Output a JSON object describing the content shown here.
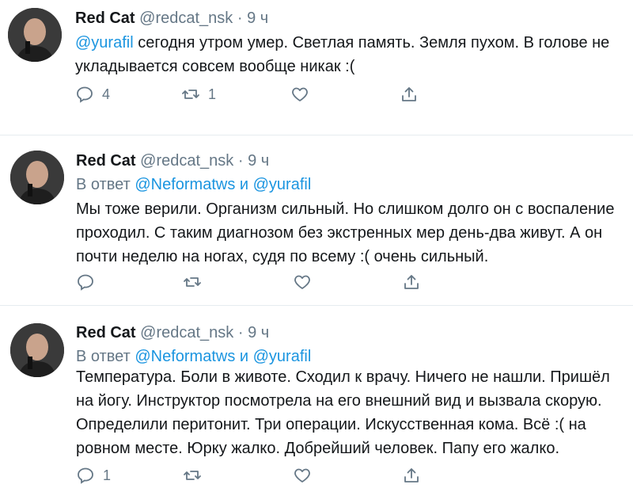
{
  "tweets": [
    {
      "name": "Red Cat",
      "handle": "@redcat_nsk",
      "dot": "·",
      "time": "9 ч",
      "reply_prefix": "",
      "reply_to_1": "",
      "reply_and": "",
      "reply_to_2": "",
      "mention": "@yurafil",
      "line1": " сегодня утром умер. Светлая память. Земля пухом. В голове не",
      "line2": "укладывается совсем вообще никак :(",
      "line3": "",
      "line4": "",
      "replies": "4",
      "retweets": "1",
      "likes": ""
    },
    {
      "name": "Red Cat",
      "handle": "@redcat_nsk",
      "dot": "·",
      "time": "9 ч",
      "reply_prefix": "В ответ ",
      "reply_to_1": "@Neformatws",
      "reply_and": " и ",
      "reply_to_2": "@yurafil",
      "mention": "",
      "line1": "Мы тоже верили. Организм сильный. Но слишком долго он с воспаление",
      "line2": "проходил. С таким диагнозом без экстренных мер день-два живут. А он",
      "line3": "почти неделю на ногах, судя по всему :( очень сильный.",
      "line4": "",
      "replies": "",
      "retweets": "",
      "likes": ""
    },
    {
      "name": "Red Cat",
      "handle": "@redcat_nsk",
      "dot": "·",
      "time": "9 ч",
      "reply_prefix": "В ответ ",
      "reply_to_1": "@Neformatws",
      "reply_and": " и ",
      "reply_to_2": "@yurafil",
      "mention": "",
      "line1": "Температура. Боли в животе. Сходил к врачу. Ничего не нашли. Пришёл",
      "line2": "на йогу. Инструктор посмотрела на его внешний вид и вызвала скорую.",
      "line3": "Определили перитонит. Три операции. Искусственная кома. Всё :( на",
      "line4": "ровном месте. Юрку жалко. Добрейший человек. Папу его жалко.",
      "replies": "1",
      "retweets": "",
      "likes": ""
    }
  ],
  "colors": {
    "link": "#1b95e0",
    "secondary": "#657786",
    "divider": "#e6ecf0"
  },
  "icons": [
    "reply-icon",
    "retweet-icon",
    "like-icon",
    "share-icon"
  ]
}
